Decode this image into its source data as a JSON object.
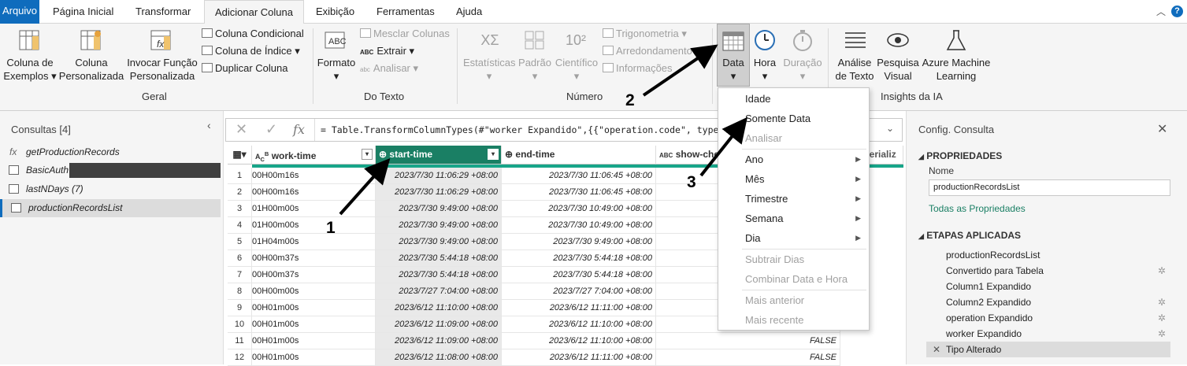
{
  "menubar": {
    "file": "Arquivo",
    "tabs": [
      "Página Inicial",
      "Transformar",
      "Adicionar Coluna",
      "Exibição",
      "Ferramentas",
      "Ajuda"
    ]
  },
  "ribbon": {
    "geral": {
      "col_exemplos": [
        "Coluna de",
        "Exemplos"
      ],
      "col_pers": [
        "Coluna",
        "Personalizada"
      ],
      "invocar": [
        "Invocar Função",
        "Personalizada"
      ],
      "condicional": "Coluna Condicional",
      "indice": "Coluna de Índice",
      "duplicar": "Duplicar Coluna",
      "label": "Geral"
    },
    "texto": {
      "formato": "Formato",
      "mesclar": "Mesclar Colunas",
      "extrair": "Extrair",
      "analisar": "Analisar",
      "label": "Do Texto"
    },
    "numero": {
      "estatisticas": "Estatísticas",
      "padrao": "Padrão",
      "cientifico": "Científico",
      "trigonometria": "Trigonometria",
      "arredondamento": "Arredondamento",
      "informacoes": "Informações",
      "label": "Número"
    },
    "data": {
      "data": "Data",
      "hora": "Hora",
      "duracao": "Duração"
    },
    "ia": {
      "analise": [
        "Análise",
        "de Texto"
      ],
      "pesquisa": [
        "Pesquisa",
        "Visual"
      ],
      "azure": [
        "Azure Machine",
        "Learning"
      ],
      "label": "Insights da IA"
    }
  },
  "queries": {
    "title": "Consultas [4]",
    "items": [
      "getProductionRecords",
      "BasicAuth",
      "lastNDays (7)",
      "productionRecordsList"
    ]
  },
  "formula": "= Table.TransformColumnTypes(#\"worker Expandido\",{{\"operation.code\", type te",
  "columns": [
    "work-time",
    "start-time",
    "end-time",
    "show-che",
    "serializ"
  ],
  "rows": [
    [
      "1",
      "00H00m16s",
      "2023/7/30 11:06:29 +08:00",
      "2023/7/30 11:06:45 +08:00",
      ""
    ],
    [
      "2",
      "00H00m16s",
      "2023/7/30 11:06:29 +08:00",
      "2023/7/30 11:06:45 +08:00",
      ""
    ],
    [
      "3",
      "01H00m00s",
      "2023/7/30 9:49:00 +08:00",
      "2023/7/30 10:49:00 +08:00",
      ""
    ],
    [
      "4",
      "01H00m00s",
      "2023/7/30 9:49:00 +08:00",
      "2023/7/30 10:49:00 +08:00",
      ""
    ],
    [
      "5",
      "01H04m00s",
      "2023/7/30 9:49:00 +08:00",
      "2023/7/30 9:49:00 +08:00",
      ""
    ],
    [
      "6",
      "00H00m37s",
      "2023/7/30 5:44:18 +08:00",
      "2023/7/30 5:44:18 +08:00",
      ""
    ],
    [
      "7",
      "00H00m37s",
      "2023/7/30 5:44:18 +08:00",
      "2023/7/30 5:44:18 +08:00",
      ""
    ],
    [
      "8",
      "00H00m00s",
      "2023/7/27 7:04:00 +08:00",
      "2023/7/27 7:04:00 +08:00",
      ""
    ],
    [
      "9",
      "00H01m00s",
      "2023/6/12 11:10:00 +08:00",
      "2023/6/12 11:11:00 +08:00",
      ""
    ],
    [
      "10",
      "00H01m00s",
      "2023/6/12 11:09:00 +08:00",
      "2023/6/12 11:10:00 +08:00",
      ""
    ],
    [
      "11",
      "00H01m00s",
      "2023/6/12 11:09:00 +08:00",
      "2023/6/12 11:10:00 +08:00",
      "FALSE"
    ],
    [
      "12",
      "00H01m00s",
      "2023/6/12 11:08:00 +08:00",
      "2023/6/12 11:11:00 +08:00",
      "FALSE"
    ]
  ],
  "dropdown": {
    "items": [
      "Idade",
      "Somente Data",
      "Analisar",
      "Ano",
      "Mês",
      "Trimestre",
      "Semana",
      "Dia",
      "Subtrair Dias",
      "Combinar Data e Hora",
      "Mais anterior",
      "Mais recente"
    ]
  },
  "config": {
    "title": "Config. Consulta",
    "propriedades": "PROPRIEDADES",
    "nome_label": "Nome",
    "nome_value": "productionRecordsList",
    "todas": "Todas as Propriedades",
    "etapas": "ETAPAS APLICADAS",
    "steps": [
      "productionRecordsList",
      "Convertido para Tabela",
      "Column1 Expandido",
      "Column2 Expandido",
      "operation Expandido",
      "worker Expandido",
      "Tipo Alterado"
    ]
  },
  "callouts": [
    "1",
    "2",
    "3"
  ],
  "colors": {
    "accent": "#0f6cbd",
    "selected_header": "#1a7f64",
    "teal_bar": "#17a589"
  }
}
